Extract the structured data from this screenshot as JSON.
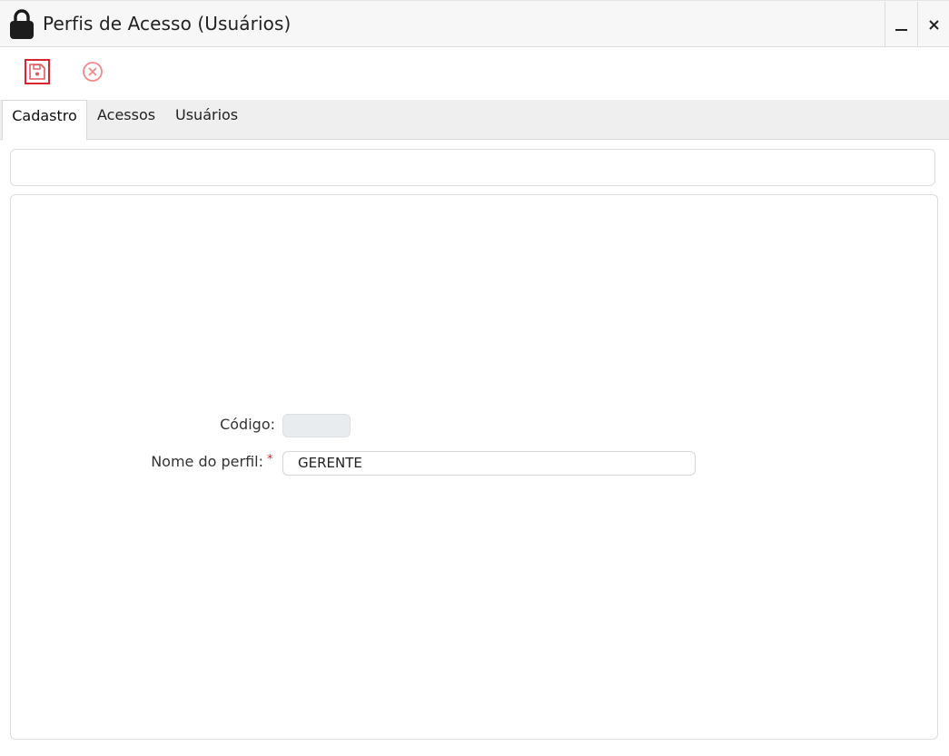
{
  "window": {
    "title": "Perfis de Acesso (Usuários)",
    "minimize_label": "_",
    "close_label": "✕"
  },
  "toolbar": {
    "save_icon": "floppy-disk-icon",
    "cancel_icon": "circle-x-icon",
    "save_color": "#d9262e",
    "cancel_color": "#f08a8a"
  },
  "tabs": [
    {
      "label": "Cadastro",
      "active": true
    },
    {
      "label": "Acessos",
      "active": false
    },
    {
      "label": "Usuários",
      "active": false
    }
  ],
  "form": {
    "codigo_label": "Código:",
    "codigo_value": "",
    "nome_label": "Nome do perfil:",
    "nome_required_mark": "*",
    "nome_value": "GERENTE"
  }
}
